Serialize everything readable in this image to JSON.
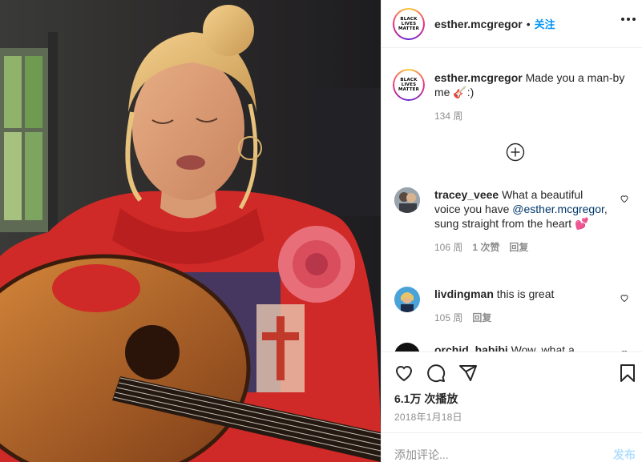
{
  "post": {
    "owner": "esther.mcgregor",
    "follow_sep": "•",
    "follow_label": "关注",
    "avatar_text": "BLACK\nLIVES\nMATTER",
    "caption": {
      "user": "esther.mcgregor",
      "text": " Made you a man-by me 🎸:)",
      "age": "134 周"
    }
  },
  "comments": [
    {
      "user": "tracey_veee",
      "text_before": " What a beautiful voice you have ",
      "mention": "@esther.mcgregor",
      "text_after": ", sung straight from the heart 💕",
      "age": "106 周",
      "likes": "1 次赞",
      "reply": "回复"
    },
    {
      "user": "livdingman",
      "text": " this is great",
      "age": "105 周",
      "reply": "回复"
    },
    {
      "user": "orchid_habibi",
      "text": " Wow, what a"
    }
  ],
  "stats": {
    "views": "6.1万 次播放",
    "date": "2018年1月18日"
  },
  "add_comment": {
    "placeholder": "添加评论...",
    "post_label": "发布"
  },
  "colors": {
    "accent": "#0095f6",
    "text": "#262626",
    "muted": "#8e8e8e",
    "hoodie": "#d42a28"
  }
}
